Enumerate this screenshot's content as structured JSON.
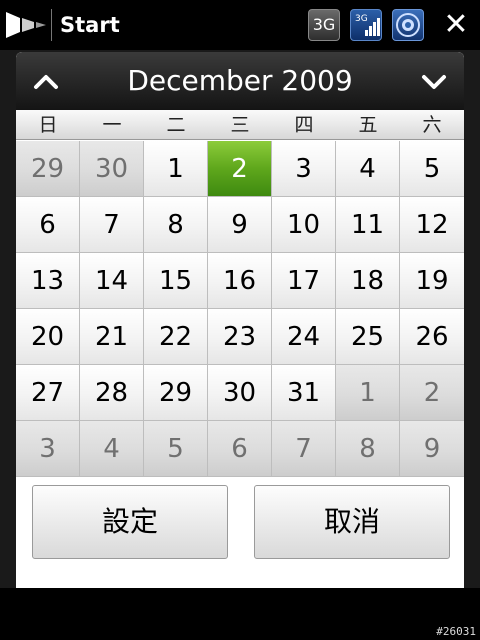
{
  "statusbar": {
    "title": "Start",
    "network_label": "3G",
    "signal_label": "3G",
    "close_glyph": "✕"
  },
  "calendar": {
    "month_label": "December 2009",
    "prev_glyph": "⌃",
    "next_glyph": "⌄",
    "weekdays": [
      "日",
      "一",
      "二",
      "三",
      "四",
      "五",
      "六"
    ],
    "weeks": [
      [
        {
          "d": "29",
          "o": true
        },
        {
          "d": "30",
          "o": true
        },
        {
          "d": "1"
        },
        {
          "d": "2",
          "sel": true
        },
        {
          "d": "3"
        },
        {
          "d": "4"
        },
        {
          "d": "5"
        }
      ],
      [
        {
          "d": "6"
        },
        {
          "d": "7"
        },
        {
          "d": "8"
        },
        {
          "d": "9"
        },
        {
          "d": "10"
        },
        {
          "d": "11"
        },
        {
          "d": "12"
        }
      ],
      [
        {
          "d": "13"
        },
        {
          "d": "14"
        },
        {
          "d": "15"
        },
        {
          "d": "16"
        },
        {
          "d": "17"
        },
        {
          "d": "18"
        },
        {
          "d": "19"
        }
      ],
      [
        {
          "d": "20"
        },
        {
          "d": "21"
        },
        {
          "d": "22"
        },
        {
          "d": "23"
        },
        {
          "d": "24"
        },
        {
          "d": "25"
        },
        {
          "d": "26"
        }
      ],
      [
        {
          "d": "27"
        },
        {
          "d": "28"
        },
        {
          "d": "29"
        },
        {
          "d": "30"
        },
        {
          "d": "31"
        },
        {
          "d": "1",
          "o": true
        },
        {
          "d": "2",
          "o": true
        }
      ],
      [
        {
          "d": "3",
          "o": true
        },
        {
          "d": "4",
          "o": true
        },
        {
          "d": "5",
          "o": true
        },
        {
          "d": "6",
          "o": true
        },
        {
          "d": "7",
          "o": true
        },
        {
          "d": "8",
          "o": true
        },
        {
          "d": "9",
          "o": true
        }
      ]
    ],
    "selected_color": "#5fa71c"
  },
  "buttons": {
    "set_label": "設定",
    "cancel_label": "取消"
  },
  "watermark": "#26031"
}
